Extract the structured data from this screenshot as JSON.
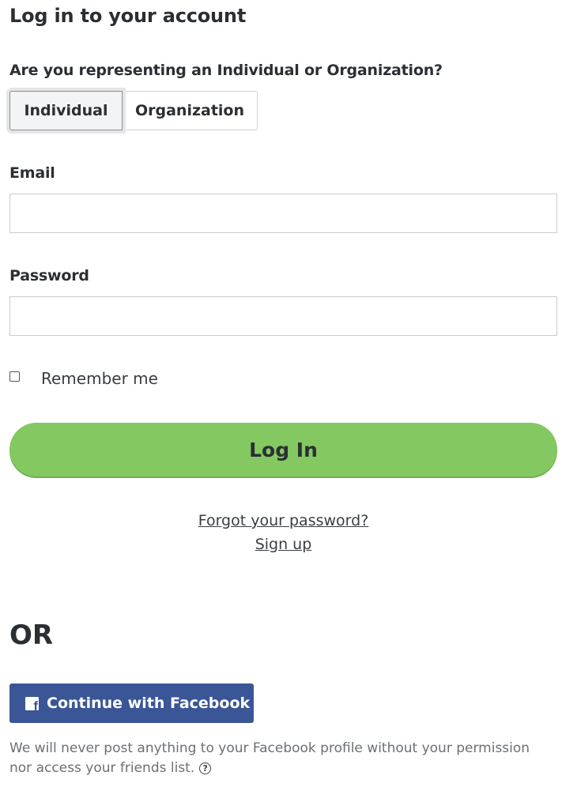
{
  "header": {
    "title": "Log in to your account"
  },
  "account_type": {
    "question": "Are you representing an Individual or Organization?",
    "options": [
      "Individual",
      "Organization"
    ],
    "selected": "Individual"
  },
  "form": {
    "email_label": "Email",
    "email_value": "",
    "password_label": "Password",
    "password_value": "",
    "remember_label": "Remember me",
    "remember_checked": false,
    "login_button": "Log In"
  },
  "links": {
    "forgot_password": "Forgot your password?",
    "sign_up": "Sign up"
  },
  "divider": {
    "or_text": "OR"
  },
  "facebook": {
    "button_label": "Continue with Facebook",
    "icon": "facebook-icon",
    "disclaimer": "We will never post anything to your Facebook profile without your permission nor access your friends list.",
    "help_icon": "question-circle-icon"
  },
  "colors": {
    "primary_green": "#84c862",
    "facebook_blue": "#3b5697",
    "text_dark": "#2b2f33",
    "text_muted": "#6b7075"
  }
}
